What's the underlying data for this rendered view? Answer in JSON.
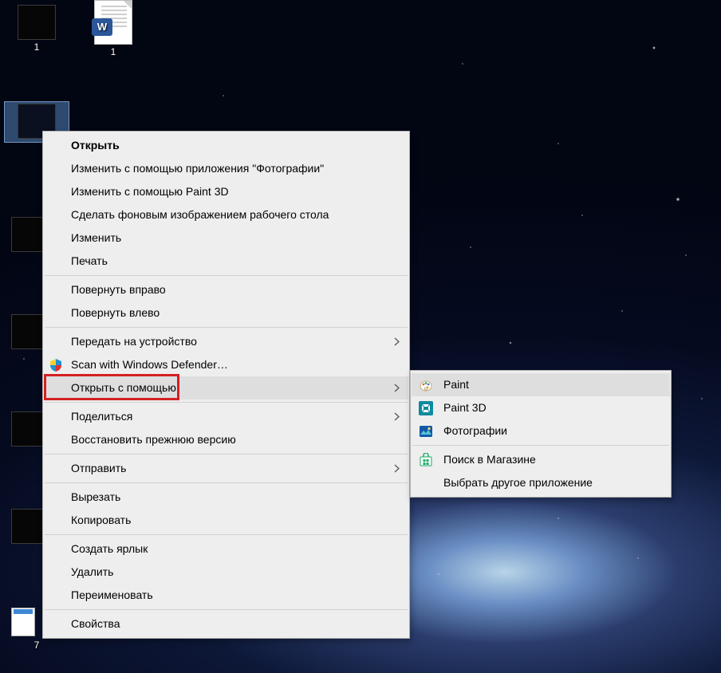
{
  "desktop_icons": {
    "row1": [
      {
        "label": "1",
        "type": "image-thumb"
      },
      {
        "label": "1",
        "type": "word-doc"
      }
    ],
    "selected_label": "",
    "bottom_label": "7"
  },
  "context_menu": {
    "groups": [
      [
        {
          "label": "Открыть",
          "bold": true
        },
        {
          "label": "Изменить с помощью приложения \"Фотографии\""
        },
        {
          "label": "Изменить с помощью Paint 3D"
        },
        {
          "label": "Сделать фоновым изображением рабочего стола"
        },
        {
          "label": "Изменить"
        },
        {
          "label": "Печать"
        }
      ],
      [
        {
          "label": "Повернуть вправо"
        },
        {
          "label": "Повернуть влево"
        }
      ],
      [
        {
          "label": "Передать на устройство",
          "submenu": true
        },
        {
          "label": "Scan with Windows Defender…",
          "icon": "defender"
        },
        {
          "label": "Открыть с помощью",
          "submenu": true,
          "hover": true,
          "highlight": true
        }
      ],
      [
        {
          "label": "Поделиться",
          "submenu": true
        },
        {
          "label": "Восстановить прежнюю версию"
        }
      ],
      [
        {
          "label": "Отправить",
          "submenu": true
        }
      ],
      [
        {
          "label": "Вырезать"
        },
        {
          "label": "Копировать"
        }
      ],
      [
        {
          "label": "Создать ярлык"
        },
        {
          "label": "Удалить"
        },
        {
          "label": "Переименовать"
        }
      ],
      [
        {
          "label": "Свойства"
        }
      ]
    ]
  },
  "open_with_submenu": {
    "items": [
      {
        "label": "Paint",
        "icon": "paint",
        "hover": true
      },
      {
        "label": "Paint 3D",
        "icon": "paint3d"
      },
      {
        "label": "Фотографии",
        "icon": "photos"
      }
    ],
    "footer": [
      {
        "label": "Поиск в Магазине",
        "icon": "store"
      },
      {
        "label": "Выбрать другое приложение"
      }
    ]
  }
}
